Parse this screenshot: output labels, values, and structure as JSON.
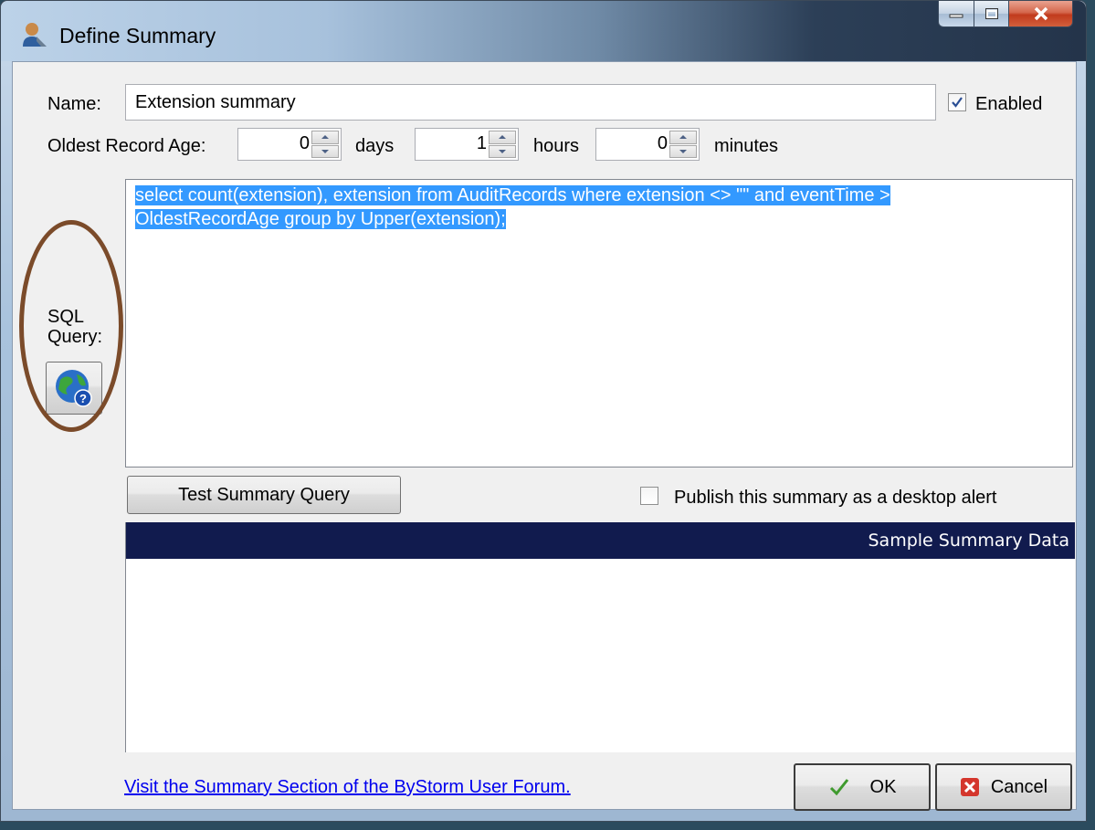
{
  "window": {
    "title": "Define Summary",
    "icon": "user-settings-icon"
  },
  "form": {
    "name_label": "Name:",
    "name_value": "Extension summary",
    "enabled_label": "Enabled",
    "enabled_checked": true,
    "oldest_label": "Oldest Record Age:",
    "days_value": "0",
    "days_label": "days",
    "hours_value": "1",
    "hours_label": "hours",
    "minutes_value": "0",
    "minutes_label": "minutes",
    "sql_label_line1": "SQL",
    "sql_label_line2": "Query:",
    "sql_help_icon": "globe-help-icon",
    "sql_text_line1": "select count(extension), extension from AuditRecords where extension <> \"\" and eventTime >",
    "sql_text_line2": "OldestRecordAge group by Upper(extension);",
    "test_button": "Test Summary Query",
    "publish_label": "Publish this summary as a desktop alert",
    "publish_checked": false,
    "grid_header": "Sample Summary Data"
  },
  "footer": {
    "forum_link": "Visit the Summary Section of the ByStorm User Forum.",
    "ok_label": "OK",
    "cancel_label": "Cancel"
  },
  "colors": {
    "selection": "#3399ff",
    "grid_header_bg": "#111b4e",
    "annotation_oval": "#7b4b2a",
    "link": "#0000ee"
  }
}
